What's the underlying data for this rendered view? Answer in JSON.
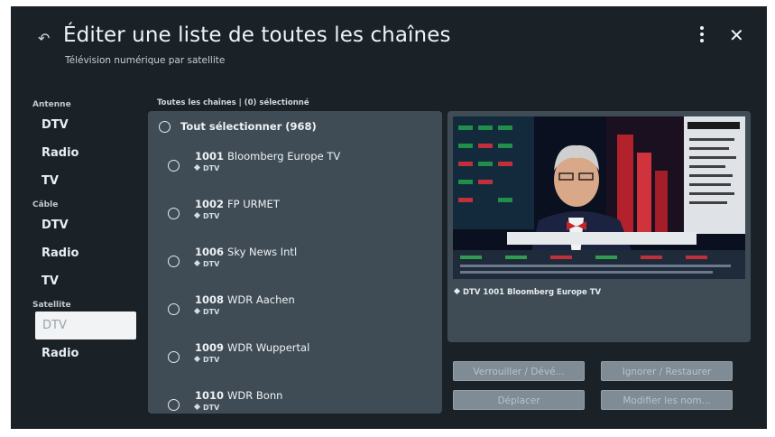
{
  "header": {
    "back_glyph": "↶",
    "title": "Éditer une liste de toutes les chaînes",
    "subtitle": "Télévision numérique par satellite",
    "close_glyph": "✕"
  },
  "sidebar": {
    "groups": [
      {
        "label": "Antenne",
        "items": [
          "DTV",
          "Radio",
          "TV"
        ]
      },
      {
        "label": "Câble",
        "items": [
          "DTV",
          "Radio",
          "TV"
        ]
      },
      {
        "label": "Satellite",
        "items": [
          "DTV",
          "Radio"
        ]
      }
    ],
    "selected": "Satellite / DTV"
  },
  "list": {
    "header": "Toutes les chaînes | (0) sélectionné",
    "select_all_label": "Tout sélectionner (968)",
    "channels": [
      {
        "number": "1001",
        "name": "Bloomberg Europe TV",
        "type": "DTV"
      },
      {
        "number": "1002",
        "name": "FP URMET",
        "type": "DTV"
      },
      {
        "number": "1006",
        "name": "Sky News Intl",
        "type": "DTV"
      },
      {
        "number": "1008",
        "name": "WDR Aachen",
        "type": "DTV"
      },
      {
        "number": "1009",
        "name": "WDR Wuppertal",
        "type": "DTV"
      },
      {
        "number": "1010",
        "name": "WDR Bonn",
        "type": "DTV"
      }
    ]
  },
  "preview": {
    "caption": "DTV 1001  Bloomberg Europe TV"
  },
  "actions": {
    "lock": "Verrouiller / Dévé...",
    "ignore": "Ignorer / Restaurer",
    "move": "Déplacer",
    "rename": "Modifier les nom..."
  },
  "colors": {
    "background": "#1a2127",
    "panel": "#3f4c56",
    "selected_item": "#f1f3f4",
    "button": "#7f8b95"
  }
}
